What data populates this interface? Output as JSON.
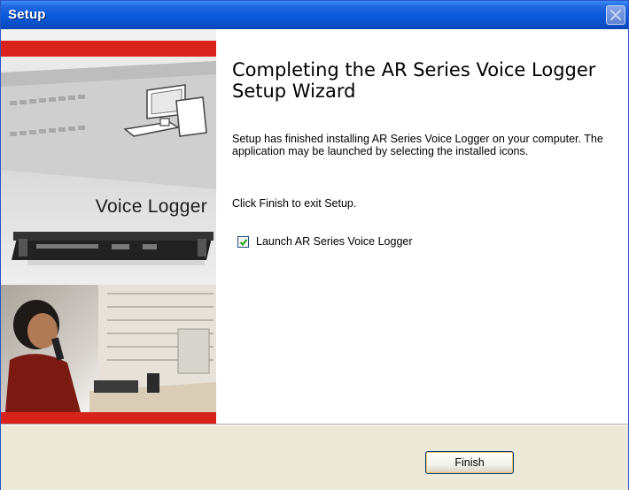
{
  "window": {
    "title": "Setup",
    "close_icon": "close-icon"
  },
  "banner": {
    "label": "Voice Logger",
    "accent_color": "#d8231c"
  },
  "wizard": {
    "heading": "Completing the AR Series Voice Logger Setup Wizard",
    "description": "Setup has finished installing AR Series Voice Logger on your computer. The application may be launched by selecting the installed icons.",
    "hint": "Click Finish to exit Setup.",
    "launch_checkbox": {
      "label": "Launch AR Series Voice Logger",
      "checked": true
    }
  },
  "footer": {
    "finish_label": "Finish"
  }
}
